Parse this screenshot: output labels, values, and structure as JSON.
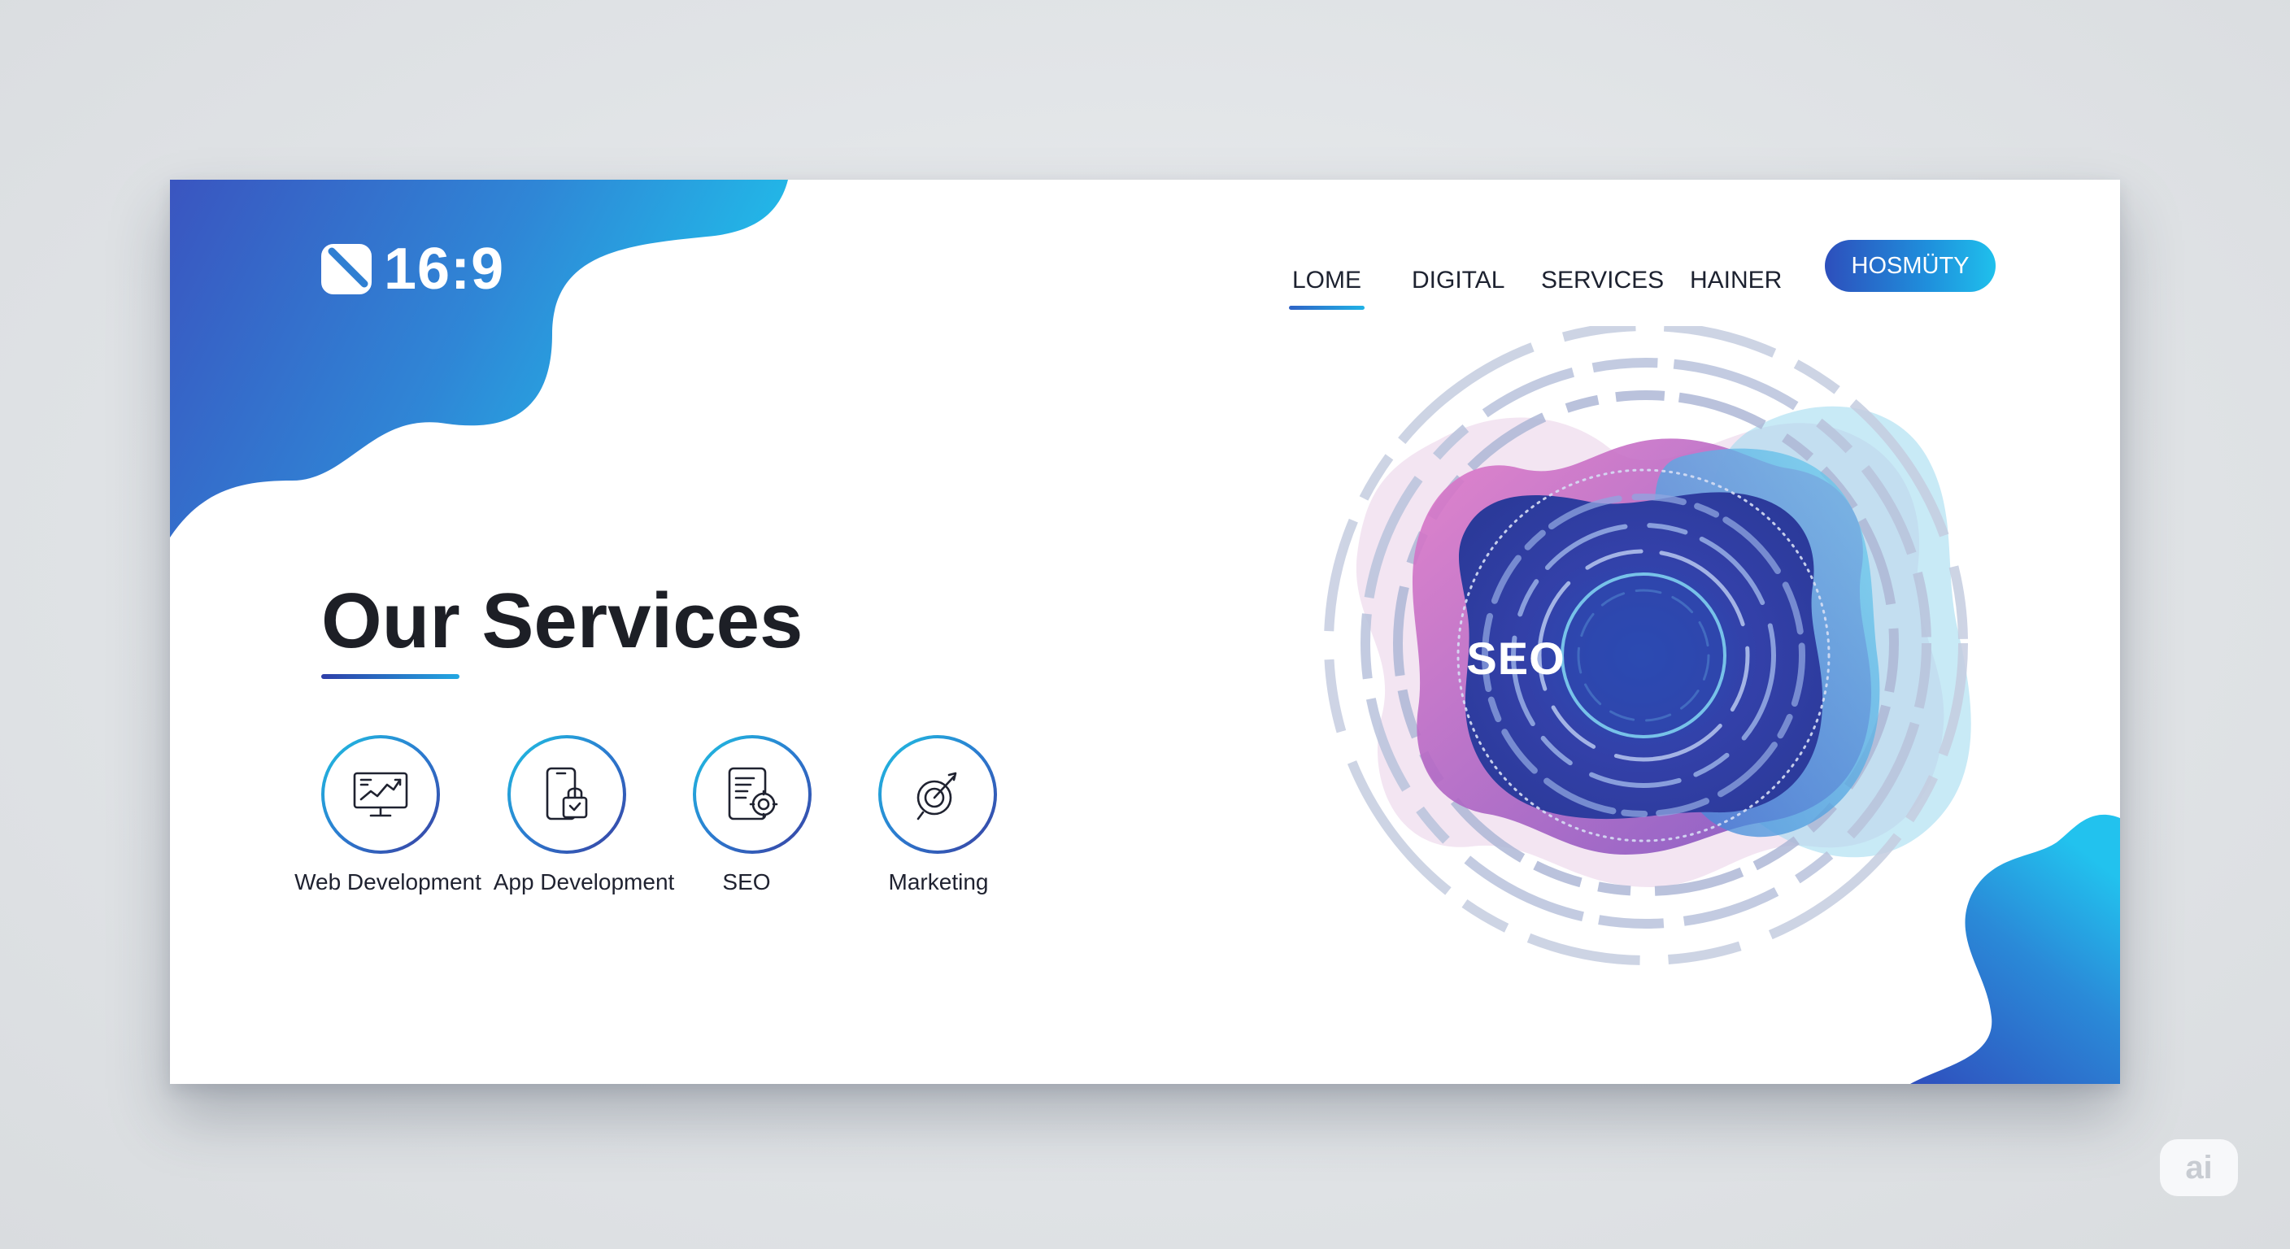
{
  "brand": {
    "logo_text": "16:9",
    "logo_icon": "slash-square-icon"
  },
  "nav": {
    "items": [
      {
        "label": "LOME",
        "active": true
      },
      {
        "label": "DIGITAL",
        "active": false
      },
      {
        "label": "SERVICES",
        "active": false
      },
      {
        "label": "HAINER",
        "active": false
      }
    ],
    "cta_label": "HOSMÜTY"
  },
  "main": {
    "heading": "Our Services",
    "services": [
      {
        "label": "Web Development",
        "icon": "monitor-chart-icon"
      },
      {
        "label": "App Development",
        "icon": "phone-lock-icon"
      },
      {
        "label": "SEO",
        "icon": "tablet-gear-icon"
      },
      {
        "label": "Marketing",
        "icon": "target-pin-icon"
      }
    ]
  },
  "hero": {
    "label": "SEO"
  },
  "watermark": {
    "label": "ai"
  },
  "colors": {
    "accent_blue": "#2f5fc4",
    "accent_cyan": "#1fc0ec",
    "accent_purple": "#7a3fb5",
    "accent_magenta": "#d25ab8",
    "text_dark": "#1d1f26",
    "card_background": "#ffffff",
    "page_background": "#e1e4e7"
  }
}
